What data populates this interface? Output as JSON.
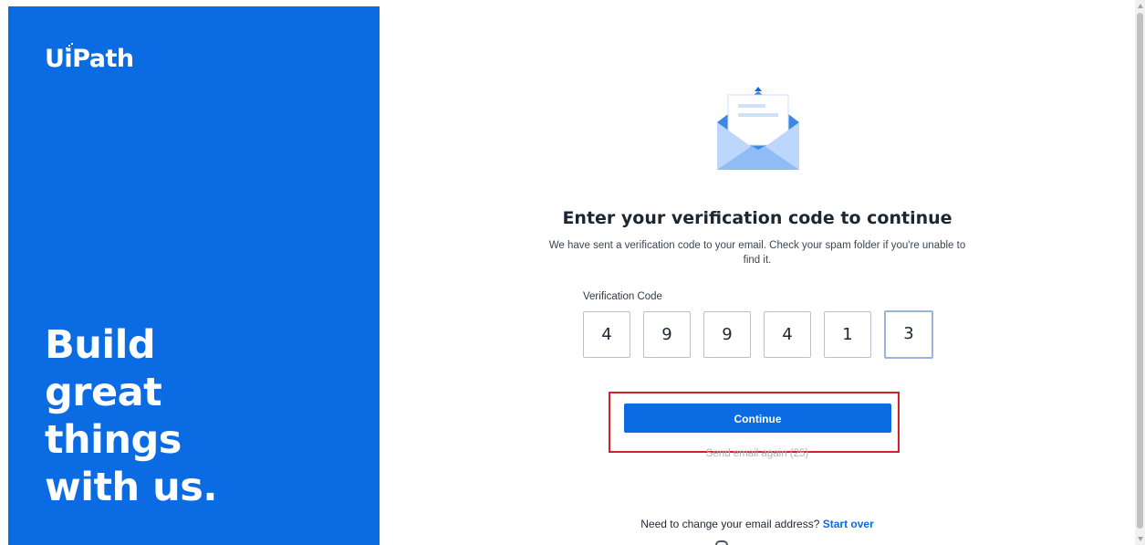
{
  "brand": {
    "logo_text": "UiPath",
    "tagline": [
      "Build",
      "great",
      "things",
      "with us."
    ],
    "panel_color": "#0a6be3"
  },
  "main": {
    "icon": "envelope-icon",
    "title": "Enter your verification code to continue",
    "subtitle": "We have sent a verification code to your email. Check your spam folder if you're unable to find it.",
    "code_label": "Verification Code",
    "code_digits": [
      "4",
      "9",
      "9",
      "4",
      "1",
      "3"
    ],
    "continue_label": "Continue",
    "resend_label": "Send email again (25)",
    "change_email_prompt": "Need to change your email address?",
    "start_over_label": "Start over"
  },
  "colors": {
    "accent": "#0a6be3",
    "highlight": "#d6202b"
  }
}
